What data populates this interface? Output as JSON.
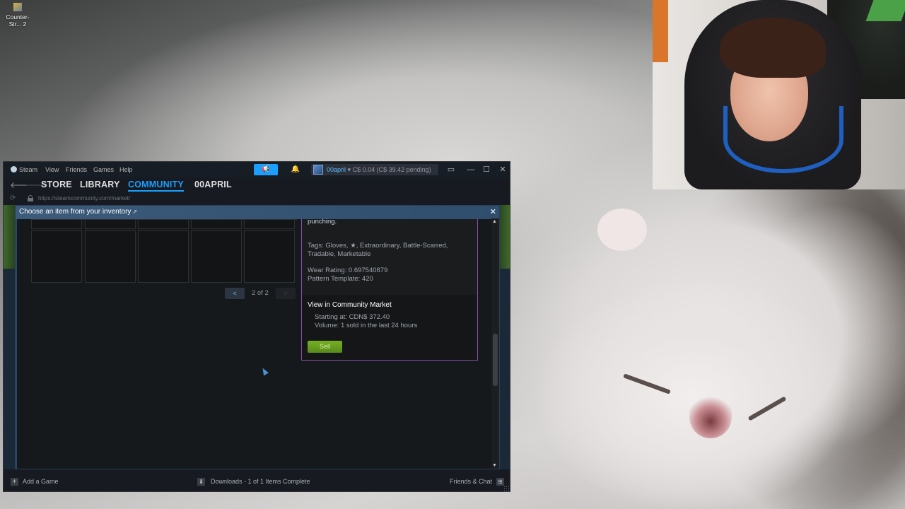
{
  "desktop": {
    "icon_label": "Counter-Str... 2"
  },
  "steam": {
    "menu": {
      "steam": "Steam",
      "view": "View",
      "friends": "Friends",
      "games": "Games",
      "help": "Help"
    },
    "account": {
      "name": "00april",
      "balance": "C$ 0.04 (C$ 39.42 pending)"
    },
    "nav": {
      "store": "STORE",
      "library": "LIBRARY",
      "community": "COMMUNITY",
      "username": "00APRIL"
    },
    "url": "https://steamcommunity.com/market/",
    "modal": {
      "title": "Choose an item from your inventory",
      "pager_prev": "<",
      "pager_text": "2 of 2",
      "pager_next": ">"
    },
    "detail": {
      "description_tail": "punching.",
      "tags_line1": "Tags: Gloves, ★, Extraordinary, Battle-Scarred,",
      "tags_line2": "Tradable, Marketable",
      "wear_rating": "Wear Rating: 0.697540879",
      "pattern_template": "Pattern Template: 420",
      "market_title": "View in Community Market",
      "starting_at": "Starting at: CDN$ 372.40",
      "volume": "Volume: 1 sold in the last 24 hours",
      "sell_label": "Sell"
    },
    "bottom": {
      "add_game": "Add a Game",
      "downloads": "Downloads - 1 of 1 Items Complete",
      "friends_chat": "Friends & Chat"
    }
  },
  "icons": {
    "back": "back-arrow-icon",
    "forward": "forward-arrow-icon",
    "lock": "lock-icon",
    "reload": "reload-icon",
    "announce": "megaphone-icon",
    "notifications": "bell-icon",
    "close": "close-icon"
  },
  "colors": {
    "accent_blue": "#1a9fff",
    "sell_green": "#75b022",
    "rarity_purple": "#8650ac"
  }
}
